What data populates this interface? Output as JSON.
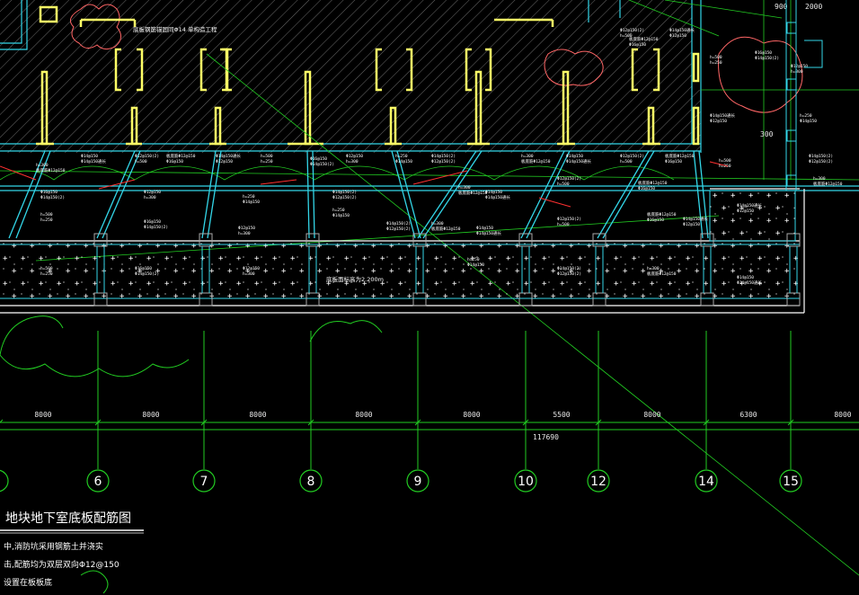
{
  "drawing": {
    "title": "地块地下室底板配筋图",
    "notes": [
      "中,消防坑采用钢筋土并浇实",
      "击,配筋均为双层双向Φ12@150",
      "设置在板板底"
    ],
    "total_dimension": "117690",
    "band_elevation_label": "底板面标高为2.200m",
    "upper_annotation": "底板钢筋锚固同Φ14 单构造工程",
    "axis_labels": [
      "6",
      "7",
      "8",
      "9",
      "10",
      "12",
      "14",
      "15"
    ],
    "span_dimensions": [
      "8000",
      "8000",
      "8000",
      "8000",
      "8000",
      "5500",
      "8000",
      "6300",
      "8000"
    ],
    "top_right_dimensions": [
      "900",
      "2000",
      "300"
    ],
    "rebar_notes": [
      "h=300",
      "Φ14@150",
      "Φ12@150(2)",
      "板底筋Φ12@150",
      "Φ14@150通长",
      "h=500",
      "Φ16@150",
      "Φ12@150",
      "h=250",
      "Φ14@150(2)"
    ],
    "colors": {
      "background": "#000000",
      "column": "#ffff66",
      "hatch": "#6a6a6a",
      "cyan_line": "#33d6e8",
      "green_line": "#22cc22",
      "red_line": "#ff3030",
      "cloud": "#ff6666",
      "axis_bubble": "#22cc22"
    }
  }
}
